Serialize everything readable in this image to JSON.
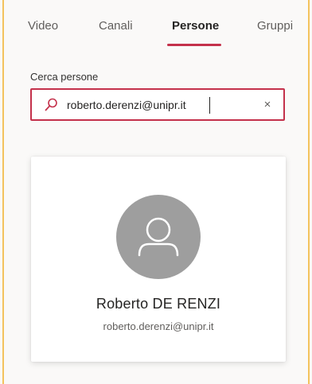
{
  "tabs": [
    {
      "label": "Video",
      "active": false
    },
    {
      "label": "Canali",
      "active": false
    },
    {
      "label": "Persone",
      "active": true
    },
    {
      "label": "Gruppi",
      "active": false
    }
  ],
  "search": {
    "label": "Cerca persone",
    "value": "roberto.derenzi@unipr.it",
    "clear_symbol": "×",
    "icon": "search-icon"
  },
  "result": {
    "name": "Roberto DE RENZI",
    "email": "roberto.derenzi@unipr.it",
    "avatar_icon": "person-icon"
  },
  "colors": {
    "accent": "#c4314b",
    "frame_border": "#f3c35d",
    "avatar_bg": "#9e9e9e"
  }
}
